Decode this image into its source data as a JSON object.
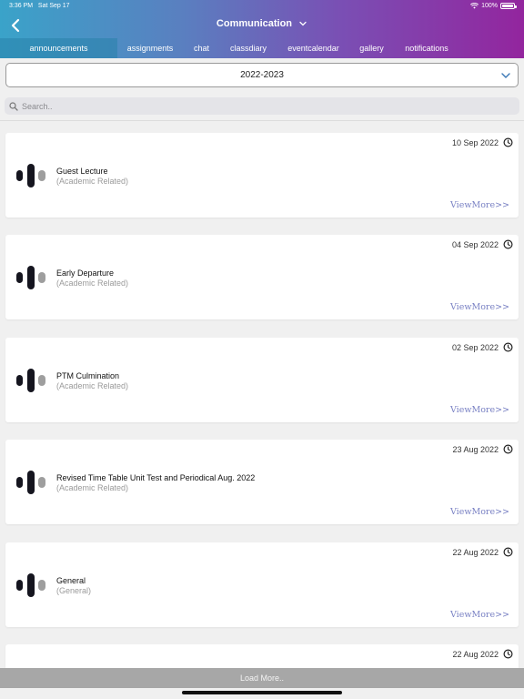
{
  "status_bar": {
    "time": "3:36 PM",
    "date": "Sat Sep 17",
    "battery": "100%"
  },
  "header": {
    "title": "Communication"
  },
  "tabs": [
    {
      "label": "announcements",
      "active": true
    },
    {
      "label": "assignments",
      "active": false
    },
    {
      "label": "chat",
      "active": false
    },
    {
      "label": "classdiary",
      "active": false
    },
    {
      "label": "eventcalendar",
      "active": false
    },
    {
      "label": "gallery",
      "active": false
    },
    {
      "label": "notifications",
      "active": false
    }
  ],
  "year_select": {
    "value": "2022-2023"
  },
  "search": {
    "placeholder": "Search.."
  },
  "announcements": [
    {
      "date": "10 Sep 2022",
      "title": "Guest Lecture",
      "category": "(Academic Related)",
      "more": "ViewMore>>"
    },
    {
      "date": "04 Sep 2022",
      "title": "Early Departure",
      "category": "(Academic Related)",
      "more": "ViewMore>>"
    },
    {
      "date": "02 Sep 2022",
      "title": "PTM Culmination",
      "category": "(Academic Related)",
      "more": "ViewMore>>"
    },
    {
      "date": "23 Aug 2022",
      "title": "Revised Time Table Unit Test and Periodical Aug. 2022",
      "category": "(Academic Related)",
      "more": "ViewMore>>"
    },
    {
      "date": "22 Aug 2022",
      "title": "General",
      "category": "(General)",
      "more": "ViewMore>>"
    },
    {
      "date": "22 Aug 2022",
      "title": "",
      "category": "",
      "more": ""
    }
  ],
  "load_more": {
    "label": "Load More.."
  },
  "colors": {
    "accent_start": "#3aa3c9",
    "accent_end": "#93259e",
    "view_more": "#7a82c4"
  }
}
